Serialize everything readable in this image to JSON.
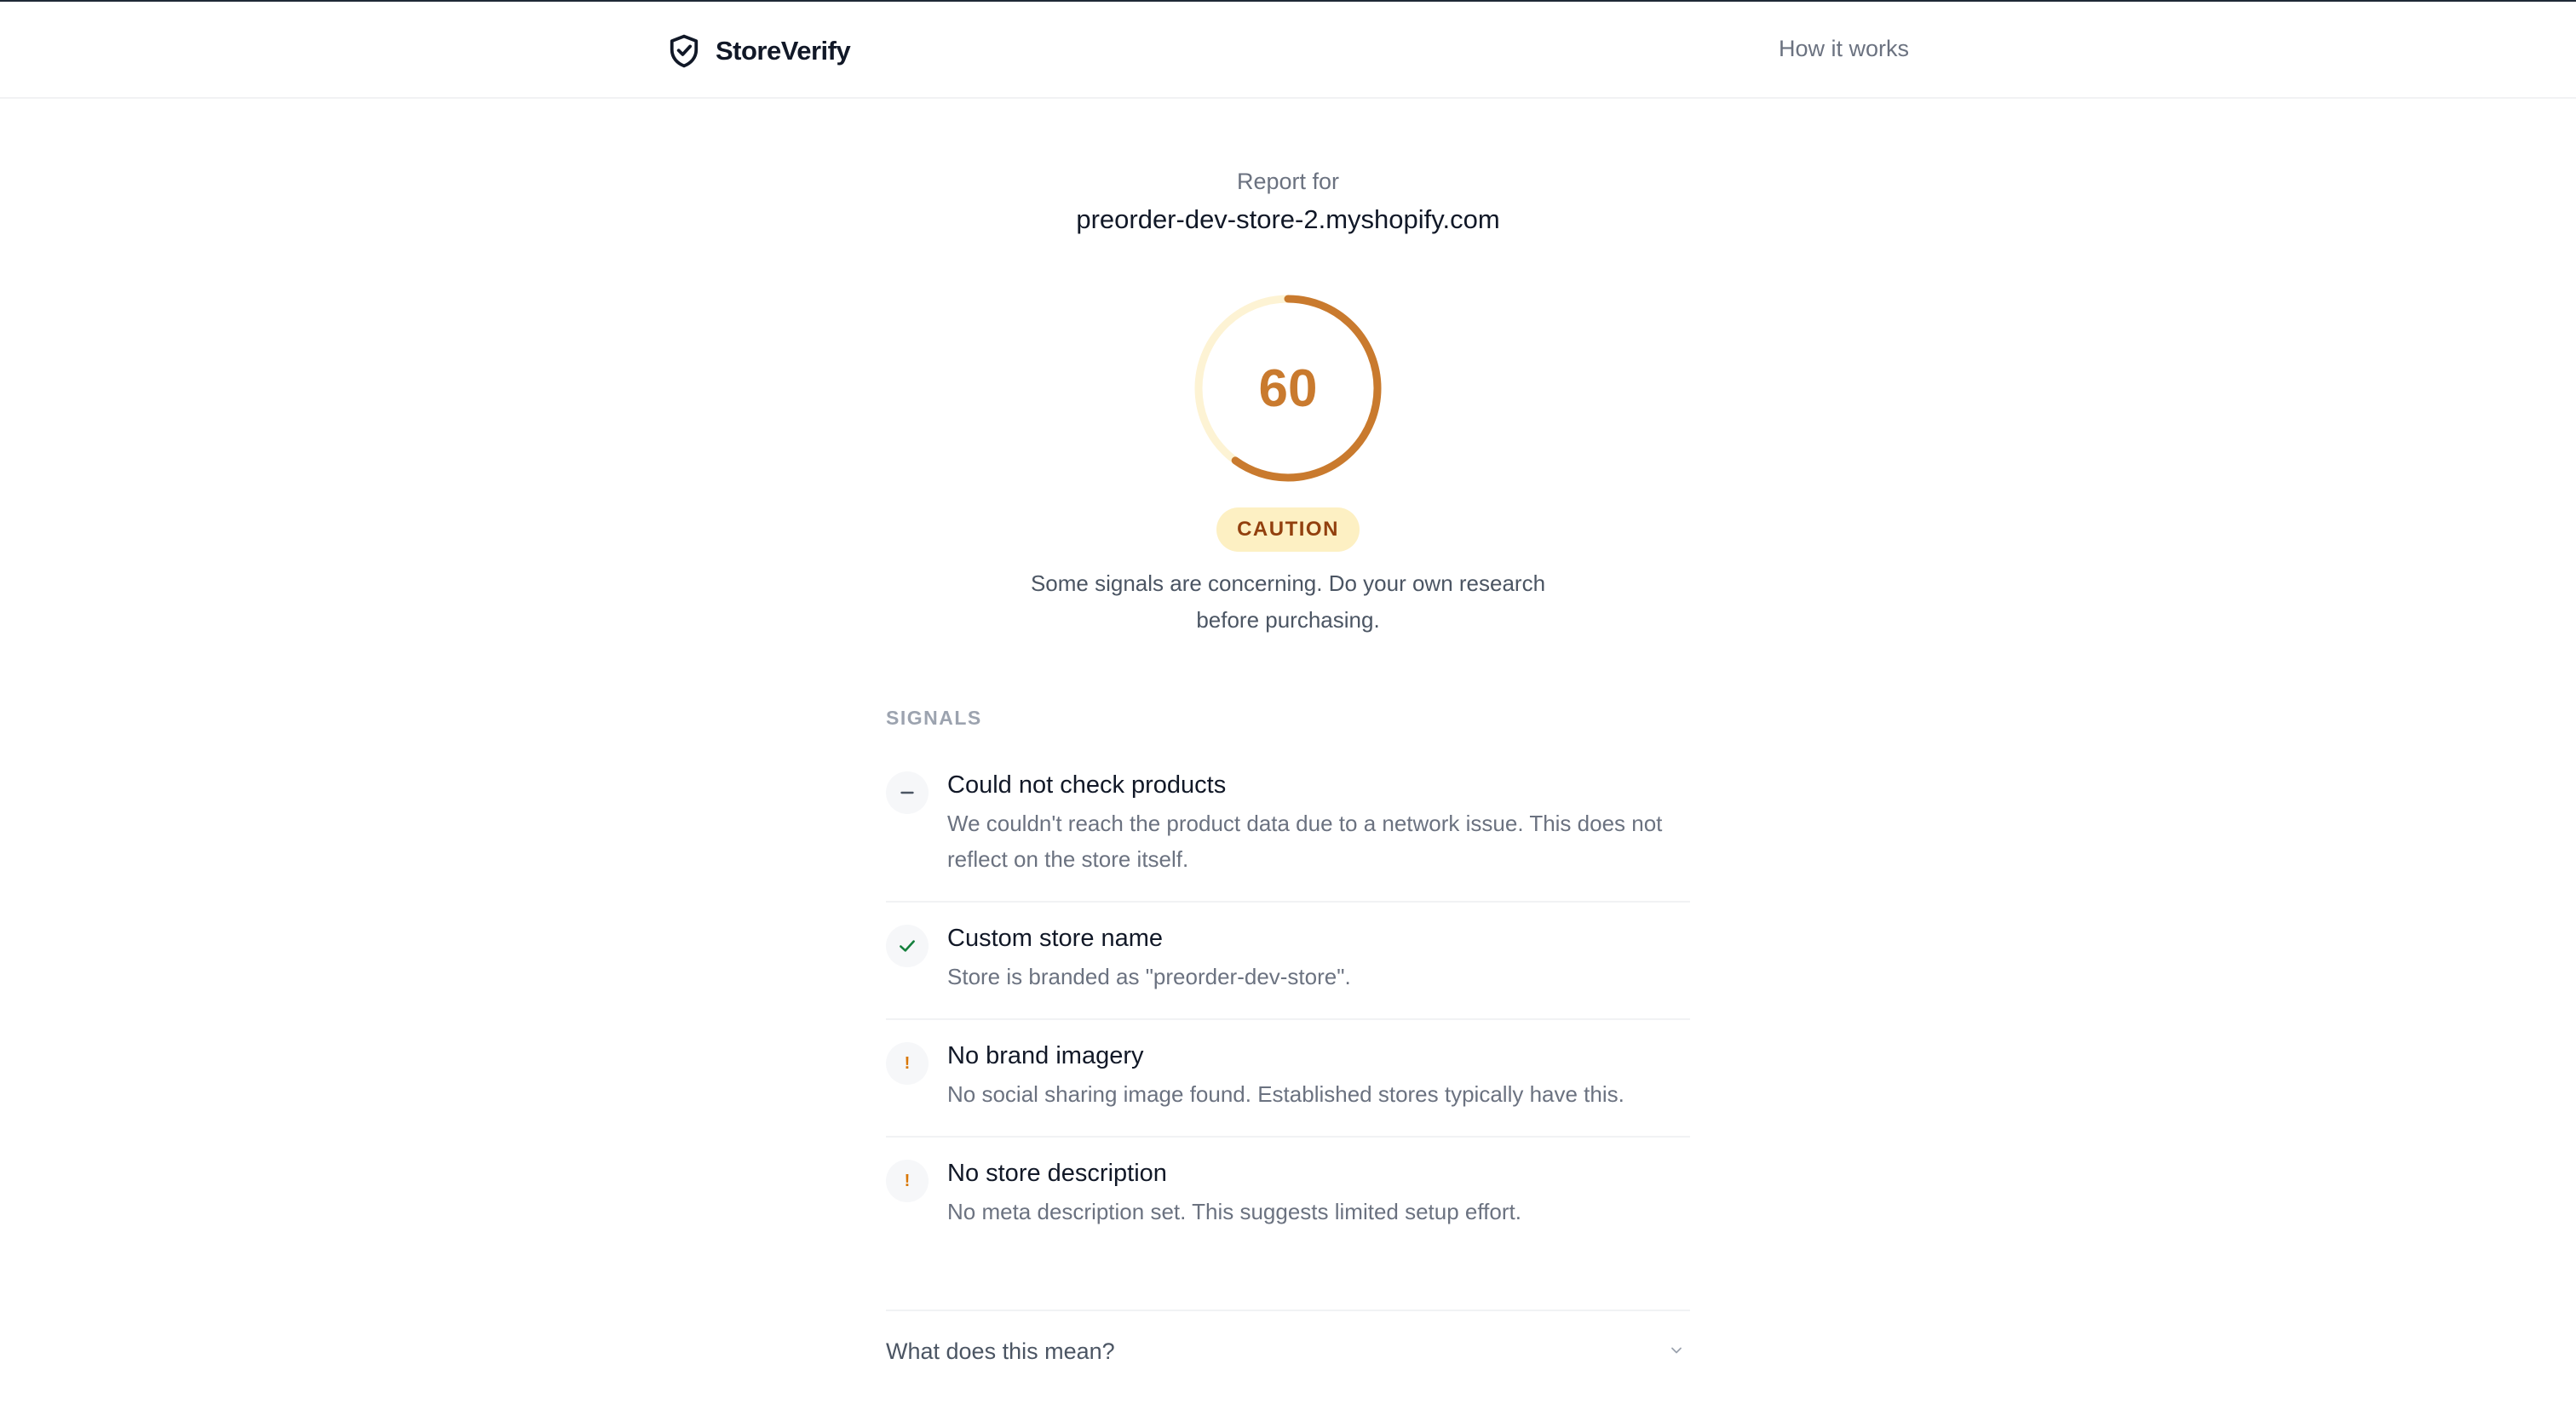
{
  "header": {
    "brand_name": "StoreVerify",
    "nav_link": "How it works"
  },
  "report": {
    "label": "Report for",
    "domain": "preorder-dev-store-2.myshopify.com",
    "score": "60",
    "score_fraction": 0.6,
    "status_badge": "CAUTION",
    "verdict": "Some signals are concerning. Do your own research before purchasing.",
    "colors": {
      "accent": "#c97a2e",
      "track": "#fdf3d4",
      "badge_bg": "#fdf0c3",
      "badge_text": "#92400e"
    }
  },
  "signals": {
    "section_title": "SIGNALS",
    "items": [
      {
        "status": "neutral",
        "icon": "minus-icon",
        "title": "Could not check products",
        "description": "We couldn't reach the product data due to a network issue. This does not reflect on the store itself."
      },
      {
        "status": "pass",
        "icon": "check-icon",
        "title": "Custom store name",
        "description": "Store is branded as \"preorder-dev-store\"."
      },
      {
        "status": "warning",
        "icon": "exclamation-icon",
        "title": "No brand imagery",
        "description": "No social sharing image found. Established stores typically have this."
      },
      {
        "status": "warning",
        "icon": "exclamation-icon",
        "title": "No store description",
        "description": "No meta description set. This suggests limited setup effort."
      }
    ]
  },
  "faq": {
    "label": "What does this mean?"
  }
}
